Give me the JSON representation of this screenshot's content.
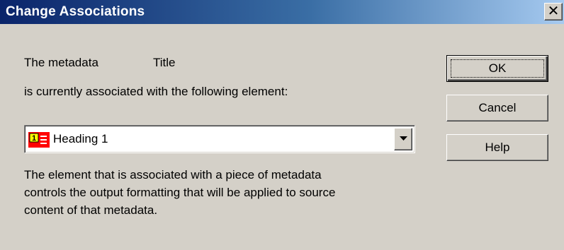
{
  "window": {
    "title": "Change Associations",
    "close_icon": "close-icon"
  },
  "content": {
    "metadata_label": "The metadata",
    "metadata_value": "Title",
    "association_line": "is currently associated with the following element:",
    "element_select": {
      "selected": "Heading 1",
      "icon": "heading-style-icon"
    },
    "description_lines": [
      "The element that is associated with a piece of metadata",
      "controls the output formatting that will be applied to source",
      "content of that metadata."
    ]
  },
  "buttons": {
    "ok": "OK",
    "cancel": "Cancel",
    "help": "Help"
  },
  "colors": {
    "titlebar_start": "#0a246a",
    "titlebar_end": "#a6caf0",
    "dialog_face": "#d4d0c8",
    "icon_red": "#ff0000",
    "icon_yellow": "#ffff00"
  }
}
